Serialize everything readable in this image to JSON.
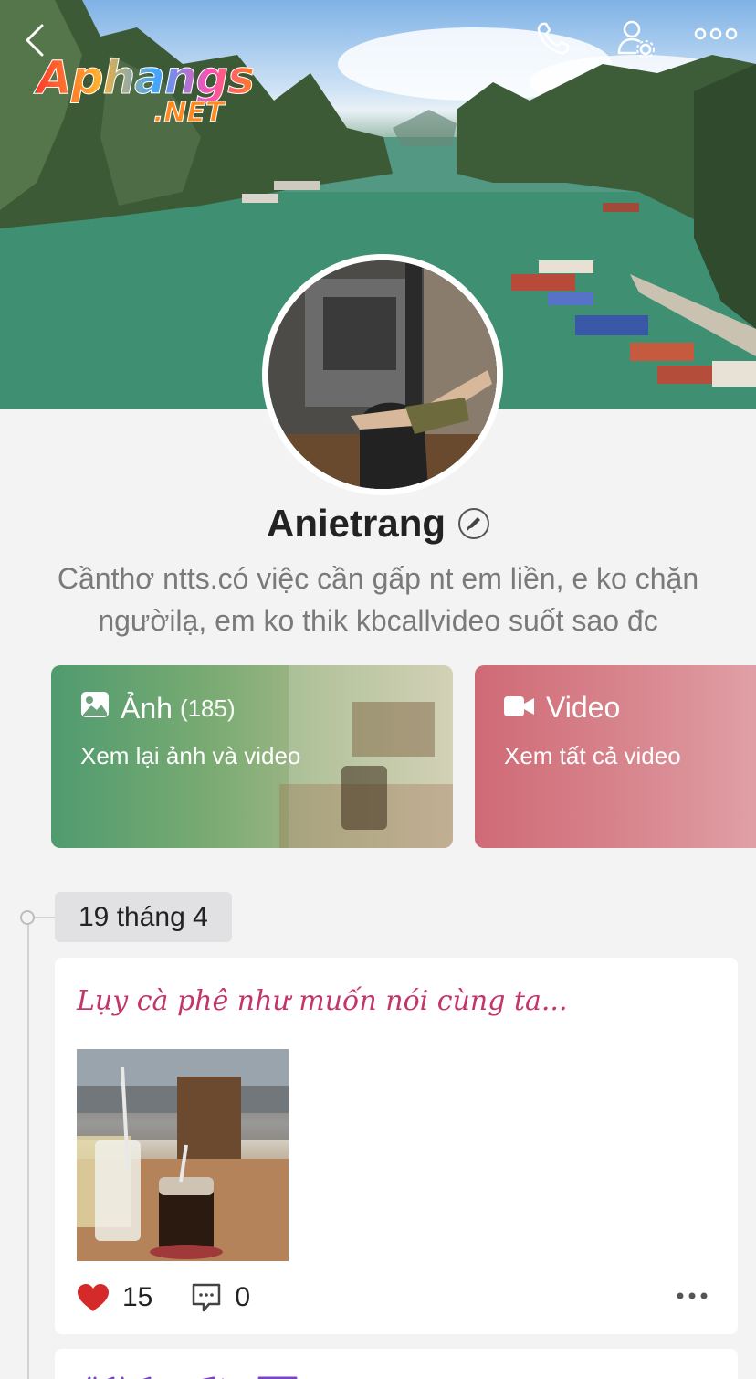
{
  "header": {
    "back_icon": "back-chevron-icon",
    "call_icon": "phone-icon",
    "settings_icon": "user-settings-icon",
    "more_icon": "more-dots-icon"
  },
  "watermark": {
    "line1": "Aphangs",
    "line2": ".NET"
  },
  "profile": {
    "name": "Anietrang",
    "bio": "Cầnthơ ntts.có việc cần gấp nt em liền, e ko chặn ngườilạ, em ko thik kbcallvideo suốt sao đc"
  },
  "cards": {
    "photos": {
      "title": "Ảnh",
      "count": "(185)",
      "subtitle": "Xem lại ảnh và video"
    },
    "videos": {
      "title": "Video",
      "subtitle": "Xem tất cả video"
    }
  },
  "timeline": {
    "date": "19 tháng 4",
    "post": {
      "text": "Lụy cà phê như muốn nói cùng ta...",
      "likes": "15",
      "comments": "0"
    }
  },
  "colors": {
    "post_text": "#c4356a",
    "heart": "#d42a2a",
    "photo_card": "#4f9b6f",
    "video_card": "#cf6a75"
  }
}
